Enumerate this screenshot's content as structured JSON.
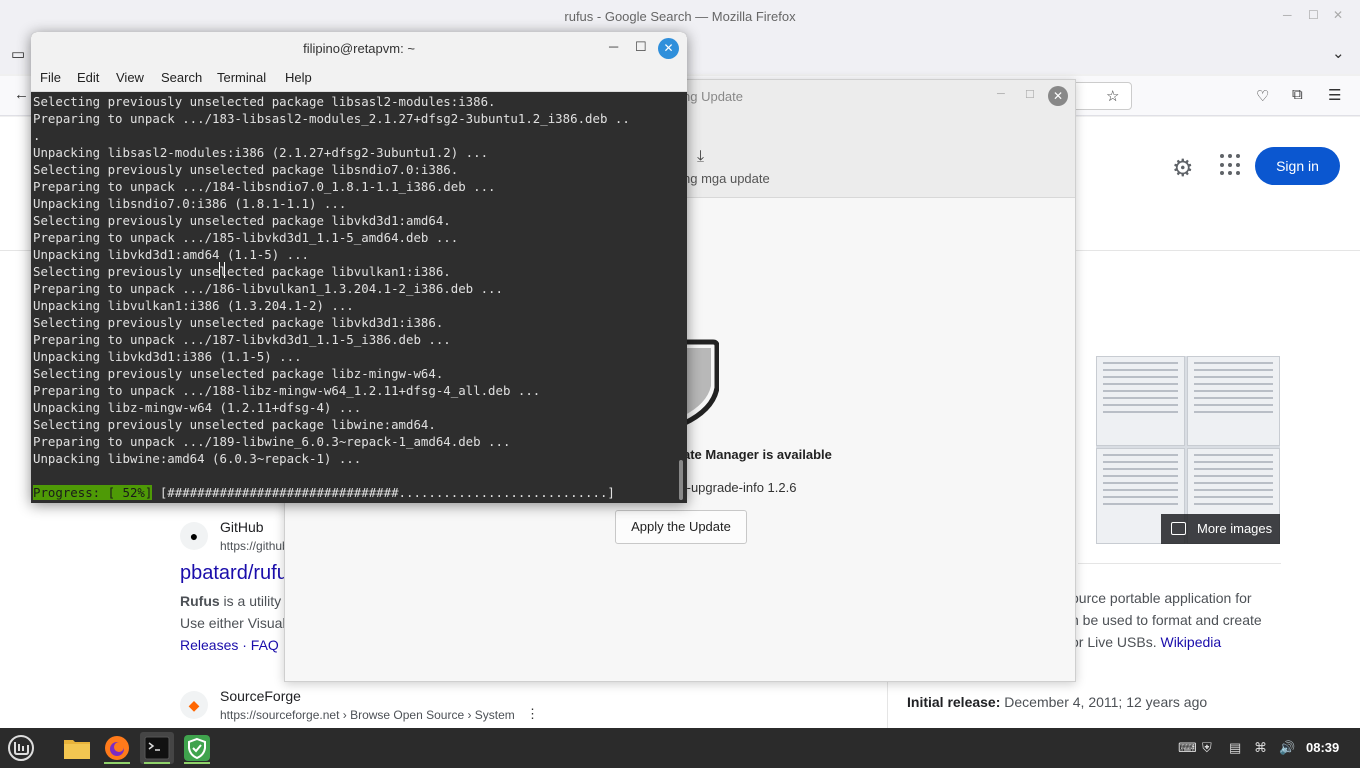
{
  "firefox": {
    "window_title": "rufus - Google Search — Mozilla Firefox",
    "sign_in": "Sign in",
    "more_images": "More images",
    "results": [
      {
        "site": "GitHub",
        "url": "https://github",
        "title": "pbatard/rufus",
        "snippet_bold": "Rufus",
        "snippet_1": " is a utility",
        "snippet_2": "Use either Visual",
        "links": "Releases · FAQ ·"
      },
      {
        "site": "SourceForge",
        "url": "https://sourceforge.net › Browse Open Source › System"
      }
    ],
    "knowledge_panel": {
      "desc_line1": "ource portable application for",
      "desc_line2": "n be used to format and create",
      "desc_line3_pre": "or Live USBs. ",
      "desc_link": "Wikipedia",
      "initial_release_label": "Initial release:",
      "initial_release_value": " December 4, 2011; 12 years ago"
    }
  },
  "update_manager": {
    "title": "ng Update",
    "download_label": "ng mga update",
    "available_text": "ate Manager is available",
    "version_text": "t-upgrade-info 1.2.6",
    "apply_button": "Apply the Update"
  },
  "terminal": {
    "title": "filipino@retapvm: ~",
    "menu": [
      "File",
      "Edit",
      "View",
      "Search",
      "Terminal",
      "Help"
    ],
    "lines": [
      "Selecting previously unselected package libsasl2-modules:i386.",
      "Preparing to unpack .../183-libsasl2-modules_2.1.27+dfsg2-3ubuntu1.2_i386.deb ..",
      ".",
      "Unpacking libsasl2-modules:i386 (2.1.27+dfsg2-3ubuntu1.2) ...",
      "Selecting previously unselected package libsndio7.0:i386.",
      "Preparing to unpack .../184-libsndio7.0_1.8.1-1.1_i386.deb ...",
      "Unpacking libsndio7.0:i386 (1.8.1-1.1) ...",
      "Selecting previously unselected package libvkd3d1:amd64.",
      "Preparing to unpack .../185-libvkd3d1_1.1-5_amd64.deb ...",
      "Unpacking libvkd3d1:amd64 (1.1-5) ...",
      "Selecting previously unselected package libvulkan1:i386.",
      "Preparing to unpack .../186-libvulkan1_1.3.204.1-2_i386.deb ...",
      "Unpacking libvulkan1:i386 (1.3.204.1-2) ...",
      "Selecting previously unselected package libvkd3d1:i386.",
      "Preparing to unpack .../187-libvkd3d1_1.1-5_i386.deb ...",
      "Unpacking libvkd3d1:i386 (1.1-5) ...",
      "Selecting previously unselected package libz-mingw-w64.",
      "Preparing to unpack .../188-libz-mingw-w64_1.2.11+dfsg-4_all.deb ...",
      "Unpacking libz-mingw-w64 (1.2.11+dfsg-4) ...",
      "Selecting previously unselected package libwine:amd64.",
      "Preparing to unpack .../189-libwine_6.0.3~repack-1_amd64.deb ...",
      "Unpacking libwine:amd64 (6.0.3~repack-1) ..."
    ],
    "progress_label": "Progress: [ 52%]",
    "progress_bar": " [###############################............................]"
  },
  "taskbar": {
    "clock": "08:39",
    "apps": [
      "menu-icon",
      "files-icon",
      "firefox-icon",
      "terminal-icon",
      "update-manager-icon"
    ]
  }
}
